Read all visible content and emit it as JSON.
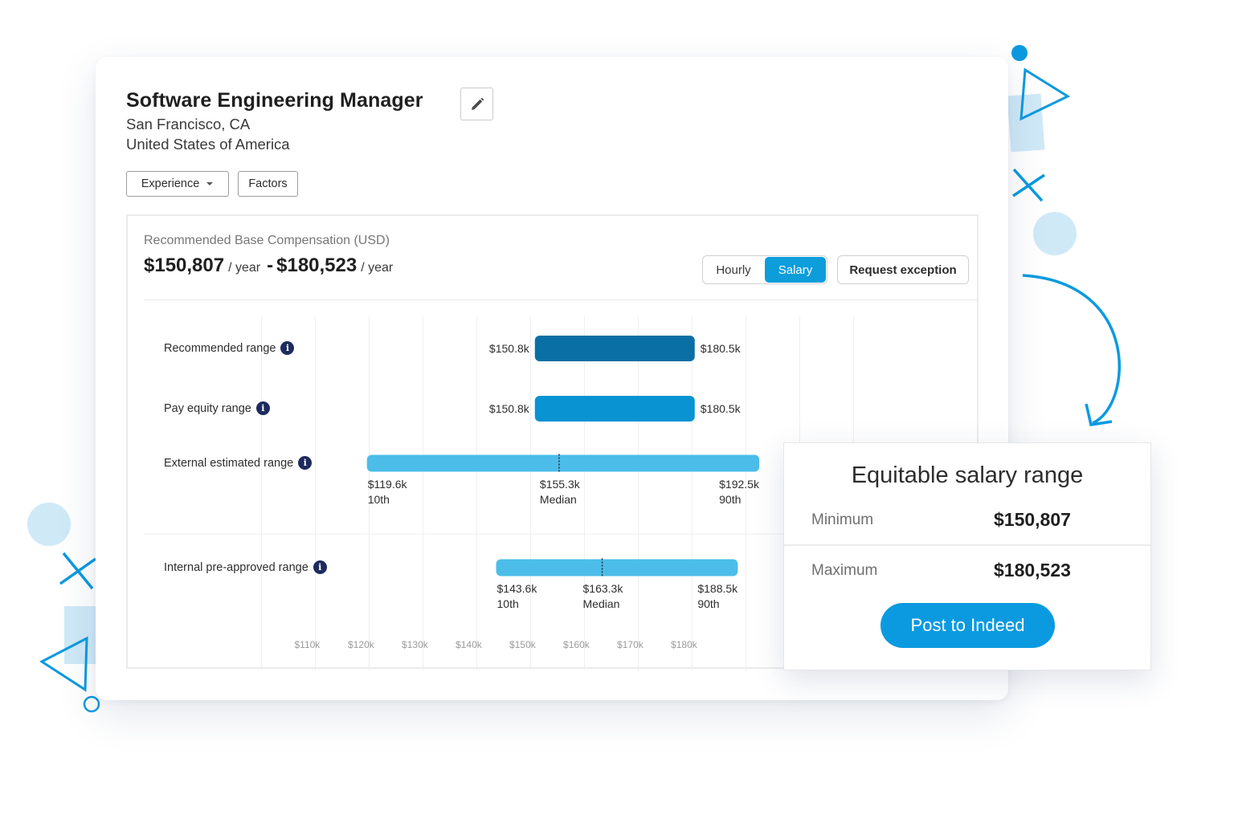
{
  "header": {
    "job_title": "Software Engineering Manager",
    "location_city": "San Francisco, CA",
    "location_country": "United States of America",
    "edit_icon": "pencil-icon"
  },
  "filters": {
    "experience_label": "Experience",
    "factors_label": "Factors"
  },
  "compensation": {
    "title": "Recommended Base Compensation (USD)",
    "min_amount": "$150,807",
    "max_amount": "$180,523",
    "per_label": "/ year",
    "separator": "-",
    "toggle": {
      "hourly": "Hourly",
      "salary": "Salary",
      "selected": "Salary"
    },
    "request_exception_label": "Request exception"
  },
  "chart_data": {
    "type": "bar",
    "orientation": "horizontal-range",
    "x_axis": {
      "ticks": [
        "$110k",
        "$120k",
        "$130k",
        "$140k",
        "$150k",
        "$160k",
        "$170k",
        "$180k"
      ]
    },
    "rows": [
      {
        "label": "Recommended range",
        "min": 150.8,
        "max": 180.5,
        "min_label": "$150.8k",
        "max_label": "$180.5k",
        "color": "#0a6fa5"
      },
      {
        "label": "Pay equity range",
        "min": 150.8,
        "max": 180.5,
        "min_label": "$150.8k",
        "max_label": "$180.5k",
        "color": "#0993d3"
      },
      {
        "label": "External estimated range",
        "min": 119.6,
        "median": 155.3,
        "max": 192.5,
        "min_label": "$119.6k",
        "median_label": "$155.3k",
        "max_label": "$192.5k",
        "min_pct": "10th",
        "median_pct": "Median",
        "max_pct": "90th",
        "color": "#4bbde8"
      },
      {
        "label": "Internal pre-approved range",
        "min": 143.6,
        "median": 163.3,
        "max": 188.5,
        "min_label": "$143.6k",
        "median_label": "$163.3k",
        "max_label": "$188.5k",
        "min_pct": "10th",
        "median_pct": "Median",
        "max_pct": "90th",
        "color": "#4bbde8"
      }
    ],
    "info_icon": "info-icon"
  },
  "popup": {
    "title": "Equitable salary range",
    "minimum_label": "Minimum",
    "minimum_value": "$150,807",
    "maximum_label": "Maximum",
    "maximum_value": "$180,523",
    "post_button": "Post to Indeed"
  },
  "colors": {
    "accent": "#0b9ae0",
    "dark_bar": "#0a6fa5",
    "mid_bar": "#0993d3",
    "light_bar": "#4bbde8",
    "info_dot": "#1d2a5e",
    "decor_light": "#cfe9f7"
  }
}
